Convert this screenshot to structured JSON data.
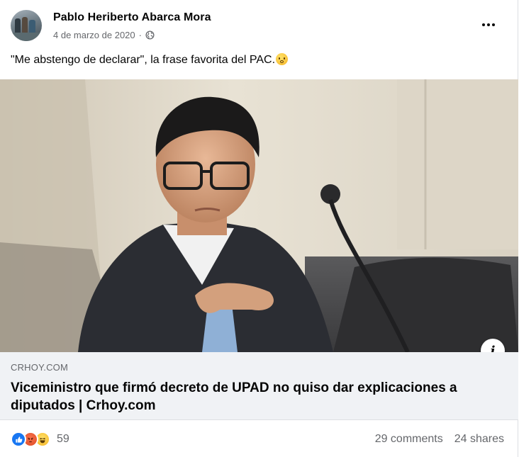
{
  "post": {
    "author": "Pablo Heriberto Abarca Mora",
    "date": "4 de marzo de 2020",
    "separator": "·",
    "text": "\"Me abstengo de declarar\", la frase favorita del PAC.",
    "emoji_icon": "flushed-face-emoji",
    "audience_icon": "globe-icon"
  },
  "link": {
    "domain": "CRHOY.COM",
    "headline": "Viceministro que firmó decreto de UPAD no quiso dar explicaciones a diputados | Crhoy.com",
    "info_label": "i"
  },
  "engagement": {
    "reaction_icons": [
      "like-icon",
      "angry-icon",
      "haha-icon"
    ],
    "reaction_count": "59",
    "comments": "29 comments",
    "shares": "24 shares"
  },
  "colors": {
    "like_blue": "#1877f2",
    "secondary_text": "#65676b",
    "footer_bg": "#f0f2f5"
  }
}
